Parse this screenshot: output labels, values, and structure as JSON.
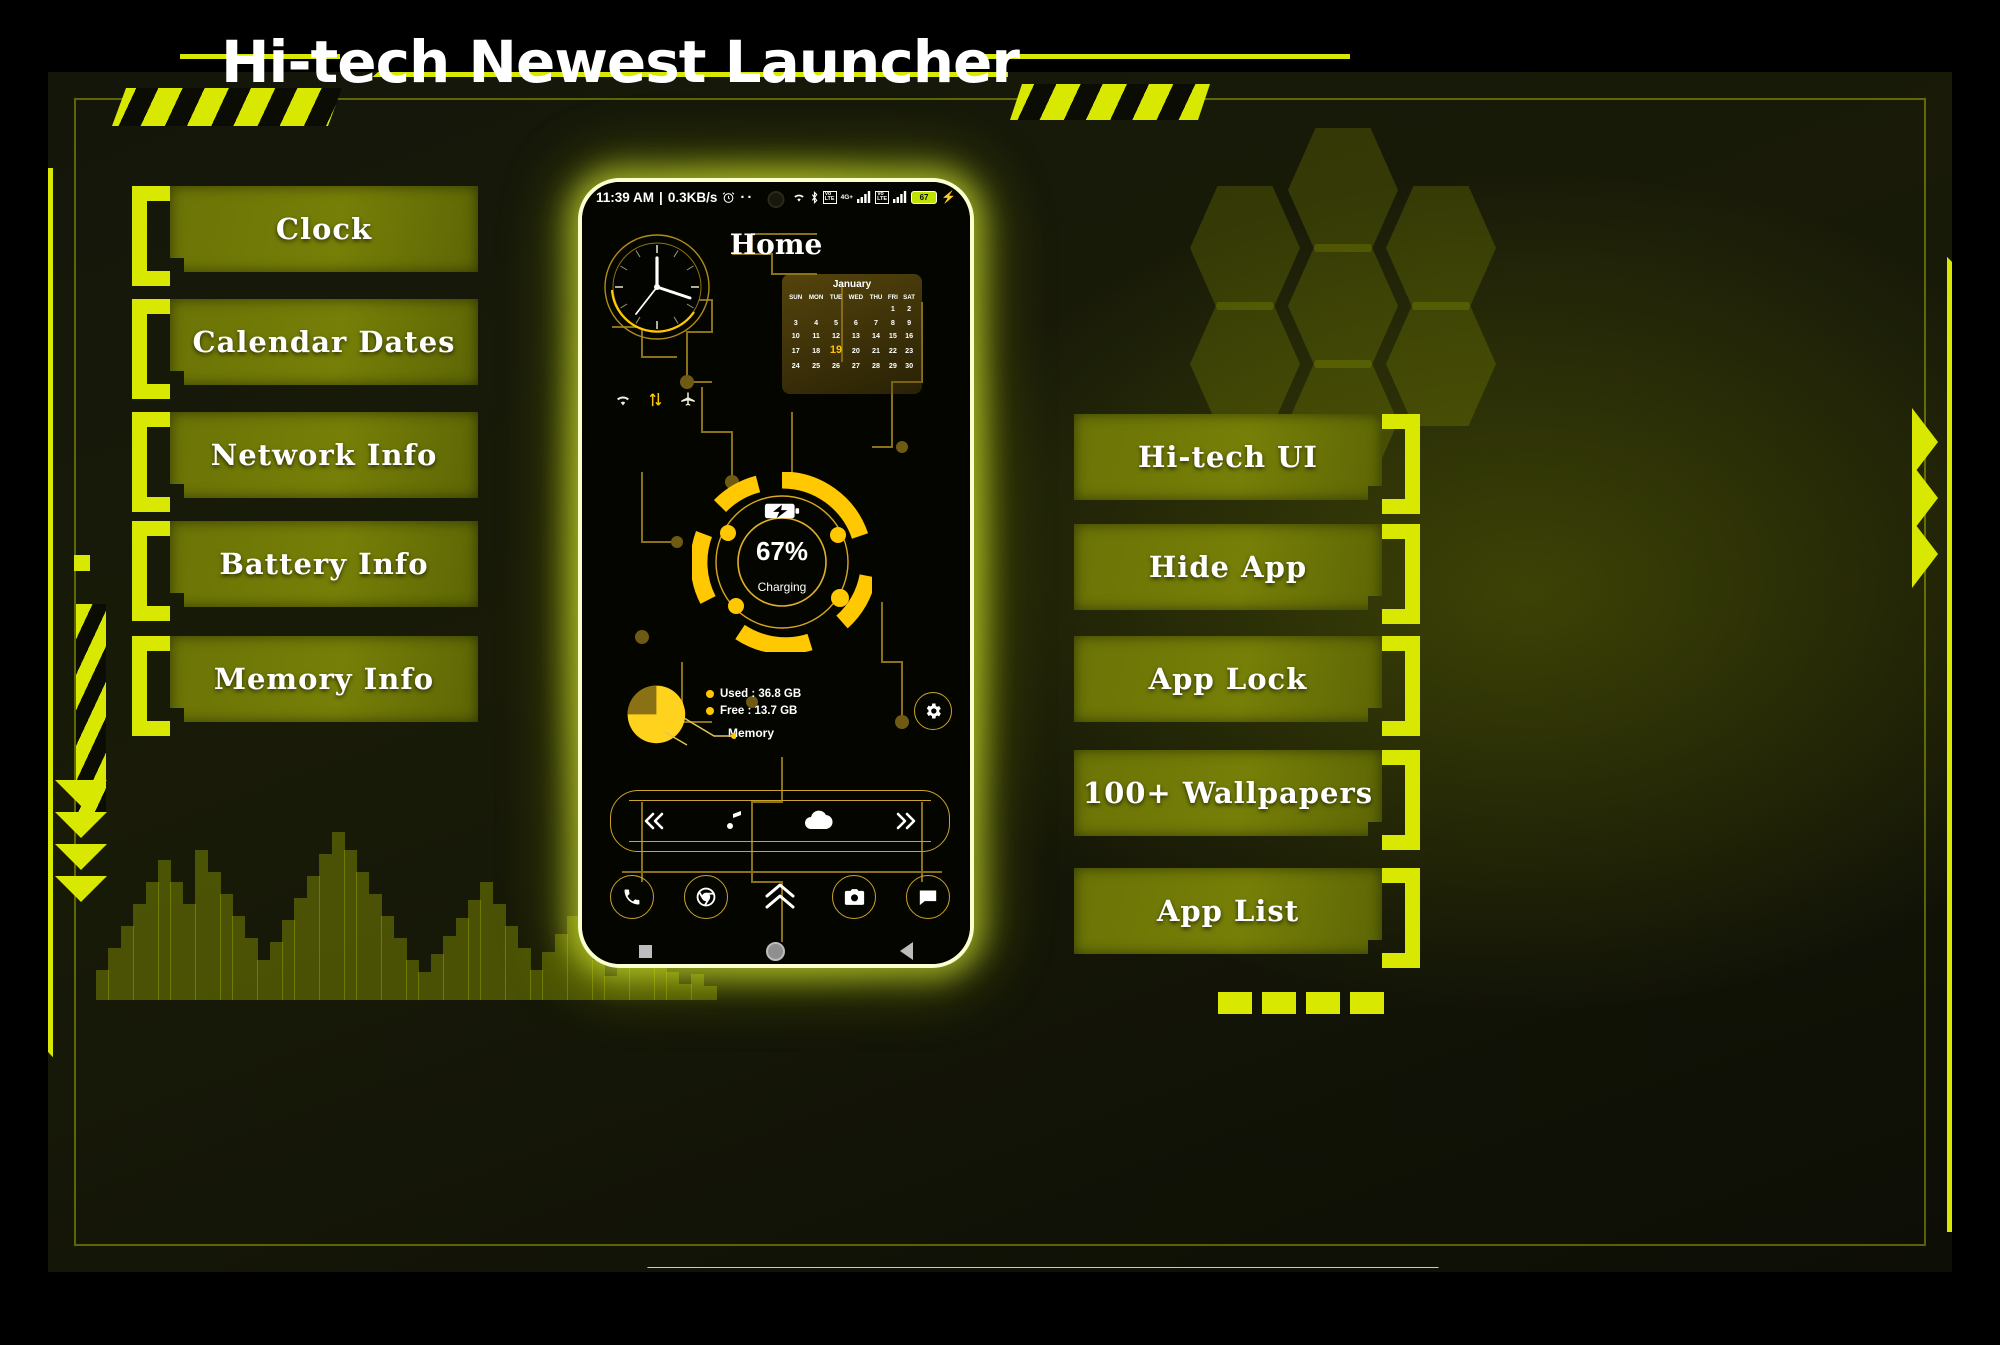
{
  "app": {
    "title": "Hi-tech Newest Launcher",
    "accent": "#d8e800",
    "panel_bg": "#6b7406",
    "phone_accent": "#ffc800"
  },
  "left_panel": {
    "buttons": [
      {
        "label": "Clock"
      },
      {
        "label": "Calendar Dates"
      },
      {
        "label": "Network Info"
      },
      {
        "label": "Battery Info"
      },
      {
        "label": "Memory Info"
      }
    ]
  },
  "right_panel": {
    "buttons": [
      {
        "label": "Hi-tech UI"
      },
      {
        "label": "Hide App"
      },
      {
        "label": "App Lock"
      },
      {
        "label": "100+ Wallpapers"
      },
      {
        "label": "App List"
      }
    ]
  },
  "phone": {
    "status_bar": {
      "time": "11:39 AM",
      "separator": "|",
      "network_speed": "0.3KB/s",
      "alarm_icon": "alarm-icon",
      "more_icon": "more-dots-icon",
      "wifi_icon": "wifi-icon",
      "bluetooth_icon": "bluetooth-icon",
      "volte1_label": "VoLTE",
      "network_type": "4G+",
      "volte2_label": "VoLTE",
      "battery_level": "67",
      "charging_icon": "charging-bolt-icon"
    },
    "home_title": "Home",
    "clock_widget": {
      "name": "analog-clock-widget"
    },
    "calendar": {
      "month": "January",
      "weekdays": [
        "SUN",
        "MON",
        "TUE",
        "WED",
        "THU",
        "FRI",
        "SAT"
      ],
      "weeks": [
        [
          "",
          "",
          "",
          "",
          "",
          "1",
          "2"
        ],
        [
          "3",
          "4",
          "5",
          "6",
          "7",
          "8",
          "9"
        ],
        [
          "10",
          "11",
          "12",
          "13",
          "14",
          "15",
          "16"
        ],
        [
          "17",
          "18",
          "19",
          "20",
          "21",
          "22",
          "23"
        ],
        [
          "24",
          "25",
          "26",
          "27",
          "28",
          "29",
          "30"
        ]
      ],
      "today": "19"
    },
    "network_icons": [
      "wifi-icon",
      "data-transfer-icon",
      "airplane-icon"
    ],
    "battery_widget": {
      "percent": "67%",
      "status": "Charging",
      "icon": "battery-charging-icon"
    },
    "memory_widget": {
      "used_label": "Used : 36.8 GB",
      "free_label": "Free : 13.7 GB",
      "title": "Memory",
      "used_value": 36.8,
      "free_value": 13.7
    },
    "settings_icon": "gear-icon",
    "music_player": {
      "prev_icon": "previous-track-icon",
      "note_icon": "music-note-icon",
      "cloud_icon": "cloud-icon",
      "next_icon": "next-track-icon"
    },
    "dock": [
      {
        "icon": "phone-icon"
      },
      {
        "icon": "chrome-icon"
      },
      {
        "icon": "app-drawer-chevron-icon"
      },
      {
        "icon": "camera-icon"
      },
      {
        "icon": "messages-icon"
      }
    ],
    "nav_bar": [
      {
        "icon": "recents-square-icon"
      },
      {
        "icon": "home-circle-icon"
      },
      {
        "icon": "back-triangle-icon"
      }
    ]
  }
}
